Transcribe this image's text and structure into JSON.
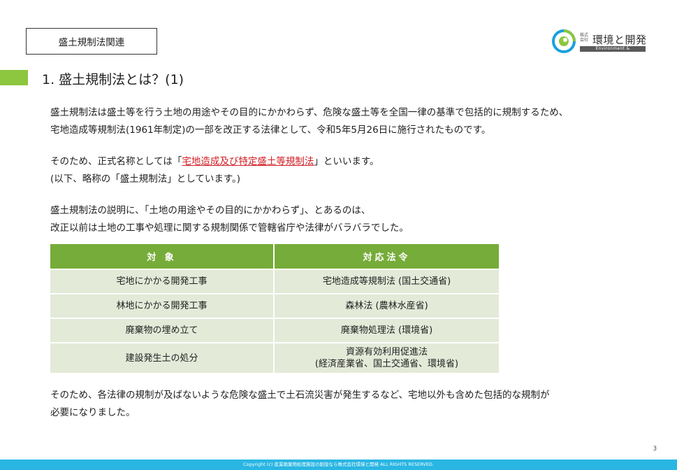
{
  "header": {
    "category": "盛土規制法関連",
    "logo": {
      "small_text": "株式会社",
      "name": "環境と開発",
      "sub": "Environment & Development",
      "colors": {
        "blue": "#1aa0dc",
        "green": "#8dc63f"
      }
    }
  },
  "title": "1. 盛土規制法とは？(1)",
  "paragraphs": {
    "p1_line1": "盛土規制法は盛土等を行う土地の用途やその目的にかかわらず、危険な盛土等を全国一律の基準で包括的に規制するため、",
    "p1_line2": "宅地造成等規制法(1961年制定)の一部を改正する法律として、令和5年5月26日に施行されたものです。",
    "p2_line1_before": "そのため、正式名称としては「",
    "p2_line1_highlight": "宅地造成及び特定盛土等規制法",
    "p2_line1_after": "」といいます。",
    "p2_line2": "(以下、略称の「盛土規制法」としています。)",
    "p3_line1": "盛土規制法の説明に、「土地の用途やその目的にかかわらず」、とあるのは、",
    "p3_line2": "改正以前は土地の工事や処理に関する規制関係で管轄省庁や法律がバラバラでした。",
    "p4_line1": "そのため、各法律の規制が及ばないような危険な盛土で土石流災害が発生するなど、宅地以外も含めた包括的な規制が",
    "p4_line2": "必要になりました。"
  },
  "table": {
    "headers": [
      "対 象",
      "対応法令"
    ],
    "rows": [
      {
        "target": "宅地にかかる開発工事",
        "law": "宅地造成等規制法 (国土交通省)",
        "law2": ""
      },
      {
        "target": "林地にかかる開発工事",
        "law": "森林法 (農林水産省)",
        "law2": ""
      },
      {
        "target": "廃棄物の埋め立て",
        "law": "廃棄物処理法 (環境省)",
        "law2": ""
      },
      {
        "target": "建設発生土の処分",
        "law": "資源有効利用促進法",
        "law2": "(経済産業省、国土交通省、環境省)"
      }
    ]
  },
  "page_number": "3",
  "footer": "Copyright (c) 産業廃棄物処理施設の創設なら株式会社環境と開発 ALL RIGHTS RESERVED.",
  "colors": {
    "accent_green": "#8dc63f",
    "table_header": "#76ac39",
    "table_cell": "#e3ead8",
    "highlight_red": "#d31f26",
    "footer_blue": "#29b6e3"
  }
}
